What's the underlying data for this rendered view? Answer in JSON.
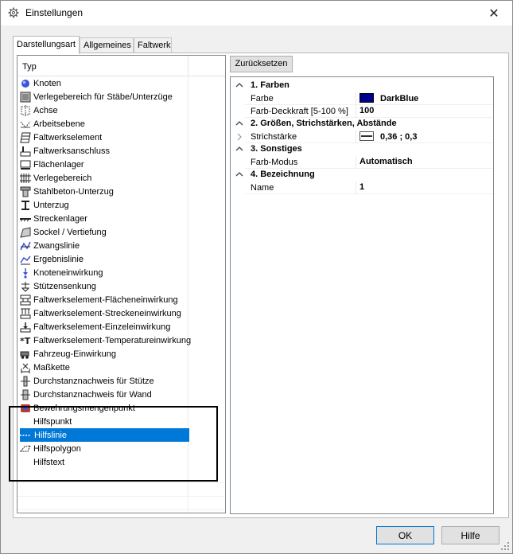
{
  "window": {
    "title": "Einstellungen",
    "close_glyph": "✕"
  },
  "tabs": [
    {
      "label": "Darstellungsart",
      "active": true
    },
    {
      "label": "Allgemeines",
      "active": false
    },
    {
      "label": "Faltwerk",
      "active": false
    }
  ],
  "list": {
    "header": "Typ",
    "items": [
      {
        "label": "Knoten",
        "icon": "node-icon"
      },
      {
        "label": "Verlegebereich für Stäbe/Unterzüge",
        "icon": "laying-area-beam-icon"
      },
      {
        "label": "Achse",
        "icon": "axis-icon"
      },
      {
        "label": "Arbeitsebene",
        "icon": "work-plane-icon"
      },
      {
        "label": "Faltwerkselement",
        "icon": "folded-plate-element-icon"
      },
      {
        "label": "Faltwerksanschluss",
        "icon": "folded-plate-connection-icon"
      },
      {
        "label": "Flächenlager",
        "icon": "area-support-icon"
      },
      {
        "label": "Verlegebereich",
        "icon": "laying-area-icon"
      },
      {
        "label": "Stahlbeton-Unterzug",
        "icon": "concrete-beam-icon"
      },
      {
        "label": "Unterzug",
        "icon": "beam-icon"
      },
      {
        "label": "Streckenlager",
        "icon": "line-support-icon"
      },
      {
        "label": "Sockel / Vertiefung",
        "icon": "pedestal-icon"
      },
      {
        "label": "Zwangslinie",
        "icon": "constraint-line-icon"
      },
      {
        "label": "Ergebnislinie",
        "icon": "result-line-icon"
      },
      {
        "label": "Knoteneinwirkung",
        "icon": "node-load-icon"
      },
      {
        "label": "Stützensenkung",
        "icon": "support-settlement-icon"
      },
      {
        "label": "Faltwerkselement-Flächeneinwirkung",
        "icon": "area-load-icon"
      },
      {
        "label": "Faltwerkselement-Streckeneinwirkung",
        "icon": "line-load-icon"
      },
      {
        "label": "Faltwerkselement-Einzeleinwirkung",
        "icon": "point-load-icon"
      },
      {
        "label": "Faltwerkselement-Temperatureinwirkung",
        "icon": "temperature-load-icon"
      },
      {
        "label": "Fahrzeug-Einwirkung",
        "icon": "vehicle-load-icon"
      },
      {
        "label": "Maßkette",
        "icon": "dimension-chain-icon"
      },
      {
        "label": "Durchstanznachweis für Stütze",
        "icon": "punching-column-icon"
      },
      {
        "label": "Durchstanznachweis für Wand",
        "icon": "punching-wall-icon"
      },
      {
        "label": "Bewehrungsmengenpunkt",
        "icon": "reinforcement-point-icon"
      },
      {
        "label": "Hilfspunkt",
        "icon": ""
      },
      {
        "label": "Hilfslinie",
        "icon": "helper-line-icon",
        "selected": true
      },
      {
        "label": "Hilfspolygon",
        "icon": "helper-polygon-icon"
      },
      {
        "label": "Hilfstext",
        "icon": ""
      }
    ]
  },
  "right": {
    "reset_label": "Zurücksetzen",
    "categories": [
      {
        "label": "1. Farben",
        "props": [
          {
            "name": "Farbe",
            "value": "DarkBlue",
            "swatch": "#00008b"
          },
          {
            "name": "Farb-Deckkraft [5-100 %]",
            "value": "100"
          }
        ]
      },
      {
        "label": "2. Größen, Strichstärken, Abstände",
        "props": [
          {
            "name": "Strichstärke",
            "value": "0,36 ; 0,3",
            "line_swatch": true
          }
        ]
      },
      {
        "label": "3. Sonstiges",
        "props": [
          {
            "name": "Farb-Modus",
            "value": "Automatisch"
          }
        ]
      },
      {
        "label": "4. Bezeichnung",
        "props": [
          {
            "name": "Name",
            "value": "1"
          }
        ]
      }
    ]
  },
  "buttons": {
    "ok": "OK",
    "help": "Hilfe"
  },
  "colors": {
    "selection": "#0078d7",
    "swatch_darkblue": "#00008b"
  }
}
